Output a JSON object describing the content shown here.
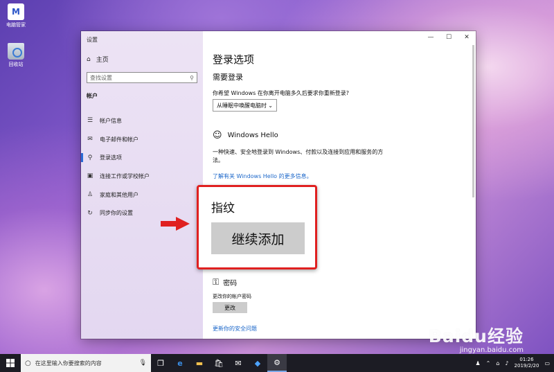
{
  "desktop": {
    "icons": [
      {
        "label": "电脑管家",
        "glyph": "M"
      },
      {
        "label": "回收站"
      }
    ]
  },
  "window": {
    "title": "设置",
    "controls": {
      "minimize": "—",
      "maximize": "☐",
      "close": "✕"
    }
  },
  "sidebar": {
    "home": "主页",
    "search_placeholder": "查找设置",
    "section": "帐户",
    "items": [
      {
        "label": "帐户信息",
        "icon": "person-card-icon",
        "glyph": "☰"
      },
      {
        "label": "电子邮件和帐户",
        "icon": "mail-icon",
        "glyph": "✉"
      },
      {
        "label": "登录选项",
        "icon": "key-icon",
        "glyph": "⚲",
        "active": true
      },
      {
        "label": "连接工作或学校帐户",
        "icon": "briefcase-icon",
        "glyph": "▣"
      },
      {
        "label": "家庭和其他用户",
        "icon": "people-icon",
        "glyph": "♙"
      },
      {
        "label": "同步你的设置",
        "icon": "sync-icon",
        "glyph": "↻"
      }
    ]
  },
  "content": {
    "title": "登录选项",
    "require_signin": "需要登录",
    "require_question": "你希望 Windows 在你离开电脑多久后要求你重新登录?",
    "require_option": "从睡眠中唤醒电脑时",
    "hello_title": "Windows Hello",
    "hello_desc": "一种快速、安全地登录到 Windows、付款以及连接到应用和服务的方法。",
    "hello_link": "了解有关 Windows Hello 的更多信息。",
    "password_title": "密码",
    "password_hint": "更改你的帐户密码",
    "password_button": "更改",
    "security_link": "更新你的安全问题"
  },
  "callout": {
    "title": "指纹",
    "button": "继续添加",
    "border_color": "#e02020"
  },
  "watermark": {
    "main": "Baidu经验",
    "sub": "jingyan.baidu.com"
  },
  "taskbar": {
    "search_placeholder": "在这里输入你要搜索的内容",
    "time": "01:26",
    "date": "2019/2/20"
  }
}
